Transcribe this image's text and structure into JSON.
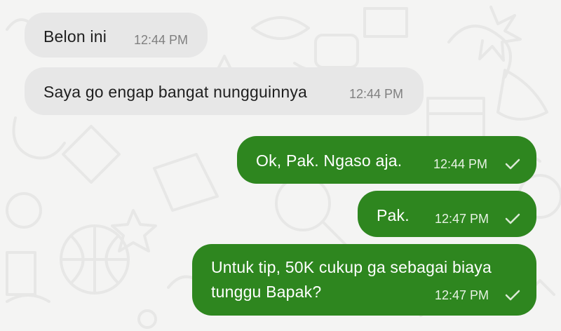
{
  "messages": [
    {
      "direction": "incoming",
      "text": "Belon ini",
      "time": "12:44 PM"
    },
    {
      "direction": "incoming",
      "text": "Saya go engap bangat nungguinnya",
      "time": "12:44 PM"
    },
    {
      "direction": "outgoing",
      "text": "Ok, Pak. Ngaso aja.",
      "time": "12:44 PM",
      "status_icon": "check-icon"
    },
    {
      "direction": "outgoing",
      "text": "Pak.",
      "time": "12:47 PM",
      "status_icon": "check-icon"
    },
    {
      "direction": "outgoing",
      "text_lines": [
        "Untuk tip, 50K cukup ga sebagai biaya",
        "tunggu Bapak?"
      ],
      "time": "12:47 PM",
      "status_icon": "check-icon"
    }
  ],
  "colors": {
    "background": "#f4f4f3",
    "incoming_bubble": "#e7e7e7",
    "outgoing_bubble": "#2e861f",
    "incoming_time": "#808080",
    "outgoing_time": "#e8f3e5",
    "doodle": "#dddddd"
  }
}
